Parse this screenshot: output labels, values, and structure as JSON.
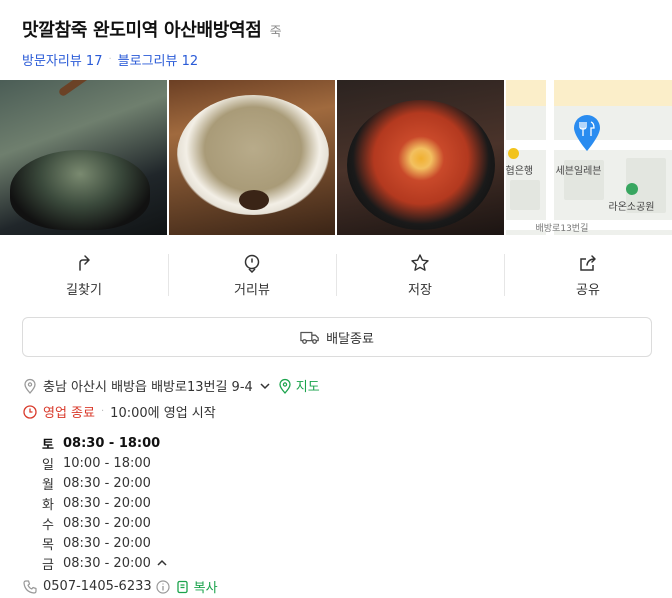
{
  "place": {
    "name": "맛깔참죽 완도미역 아산배방역점",
    "category": "죽",
    "visitor_reviews": "방문자리뷰 17",
    "blog_reviews": "블로그리뷰 12"
  },
  "map": {
    "labels": {
      "bank": "협은행",
      "store": "세븐일레븐",
      "park": "라온소공원",
      "road": "배방로13번길"
    }
  },
  "actions": [
    {
      "label": "길찾기",
      "icon": "directions-icon"
    },
    {
      "label": "거리뷰",
      "icon": "street-view-icon"
    },
    {
      "label": "저장",
      "icon": "star-icon"
    },
    {
      "label": "공유",
      "icon": "share-icon"
    }
  ],
  "delivery": {
    "label": "배달종료",
    "icon": "delivery-truck-icon"
  },
  "address": {
    "text": "충남 아산시 배방읍 배방로13번길 9-4",
    "map_link": "지도"
  },
  "hours": {
    "status": "영업 종료",
    "next": "10:00에 영업 시작",
    "schedule": [
      {
        "day": "토",
        "time": "08:30 - 18:00",
        "today": true
      },
      {
        "day": "일",
        "time": "10:00 - 18:00"
      },
      {
        "day": "월",
        "time": "08:30 - 20:00"
      },
      {
        "day": "화",
        "time": "08:30 - 20:00"
      },
      {
        "day": "수",
        "time": "08:30 - 20:00"
      },
      {
        "day": "목",
        "time": "08:30 - 20:00"
      },
      {
        "day": "금",
        "time": "08:30 - 20:00"
      }
    ]
  },
  "phone": {
    "number": "0507-1405-6233",
    "copy_label": "복사"
  },
  "colors": {
    "link_blue": "#2a5bd7",
    "green": "#1ba34c",
    "closed_red": "#d93a2b",
    "map_pin": "#2a8cf0"
  }
}
